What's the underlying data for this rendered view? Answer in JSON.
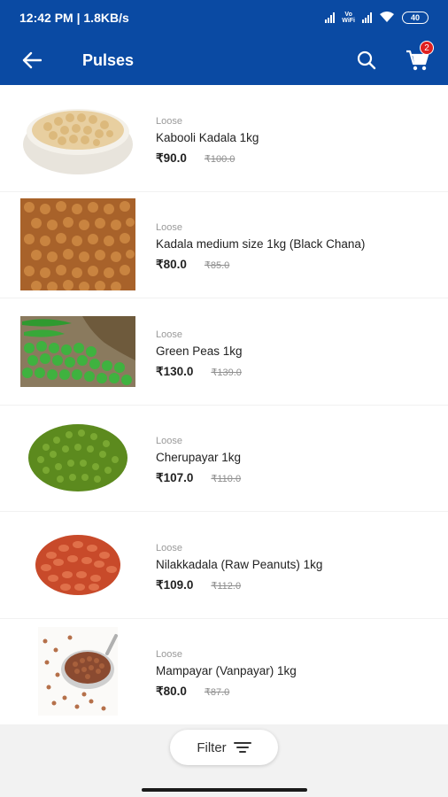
{
  "status_bar": {
    "time_speed": "12:42 PM | 1.8KB/s",
    "volte_line1": "Vo",
    "volte_line2": "WiFi",
    "battery": "40"
  },
  "header": {
    "title": "Pulses",
    "cart_count": "2"
  },
  "products": [
    {
      "tag": "Loose",
      "name": "Kabooli Kadala 1kg",
      "price": "₹90.0",
      "mrp": "₹100.0",
      "image": "chickpeas-bowl"
    },
    {
      "tag": "Loose",
      "name": "Kadala medium size 1kg (Black Chana)",
      "price": "₹80.0",
      "mrp": "₹85.0",
      "image": "black-chana"
    },
    {
      "tag": "Loose",
      "name": "Green Peas 1kg",
      "price": "₹130.0",
      "mrp": "₹139.0",
      "image": "green-peas"
    },
    {
      "tag": "Loose",
      "name": "Cherupayar  1kg",
      "price": "₹107.0",
      "mrp": "₹110.0",
      "image": "green-gram"
    },
    {
      "tag": "Loose",
      "name": "Nilakkadala (Raw Peanuts) 1kg",
      "price": "₹109.0",
      "mrp": "₹112.0",
      "image": "peanuts"
    },
    {
      "tag": "Loose",
      "name": "Mampayar (Vanpayar) 1kg",
      "price": "₹80.0",
      "mrp": "₹87.0",
      "image": "red-cowpea"
    }
  ],
  "filter": {
    "label": "Filter"
  },
  "colors": {
    "primary": "#0a4aa3",
    "badge": "#e02020"
  }
}
